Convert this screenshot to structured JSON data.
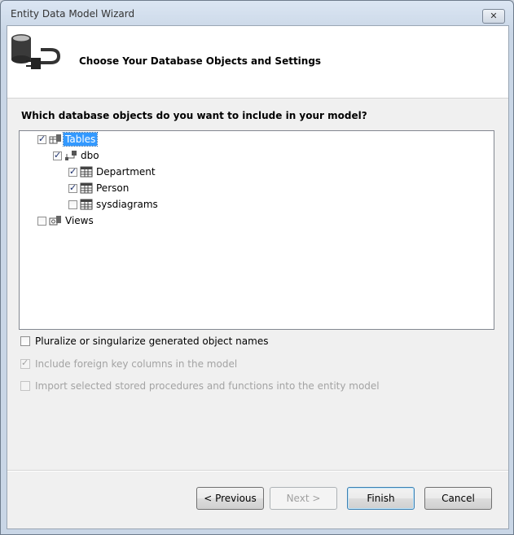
{
  "window": {
    "title": "Entity Data Model Wizard",
    "close_label": "✕"
  },
  "header": {
    "title": "Choose Your Database Objects and Settings"
  },
  "question": "Which database objects do you want to include in your model?",
  "tree": {
    "tables": {
      "label": "Tables",
      "checked": true,
      "selected": true
    },
    "schema": {
      "label": "dbo",
      "checked": true
    },
    "items": [
      {
        "label": "Department",
        "checked": true
      },
      {
        "label": "Person",
        "checked": true
      },
      {
        "label": "sysdiagrams",
        "checked": false
      }
    ],
    "views": {
      "label": "Views",
      "checked": false
    }
  },
  "options": {
    "pluralize": {
      "label": "Pluralize or singularize generated object names",
      "checked": false,
      "enabled": true
    },
    "foreign_keys": {
      "label": "Include foreign key columns in the model",
      "checked": true,
      "enabled": false
    },
    "stored_procs": {
      "label": "Import selected stored procedures and functions into the entity model",
      "checked": false,
      "enabled": false
    }
  },
  "buttons": {
    "previous": "< Previous",
    "next": "Next >",
    "finish": "Finish",
    "cancel": "Cancel"
  }
}
